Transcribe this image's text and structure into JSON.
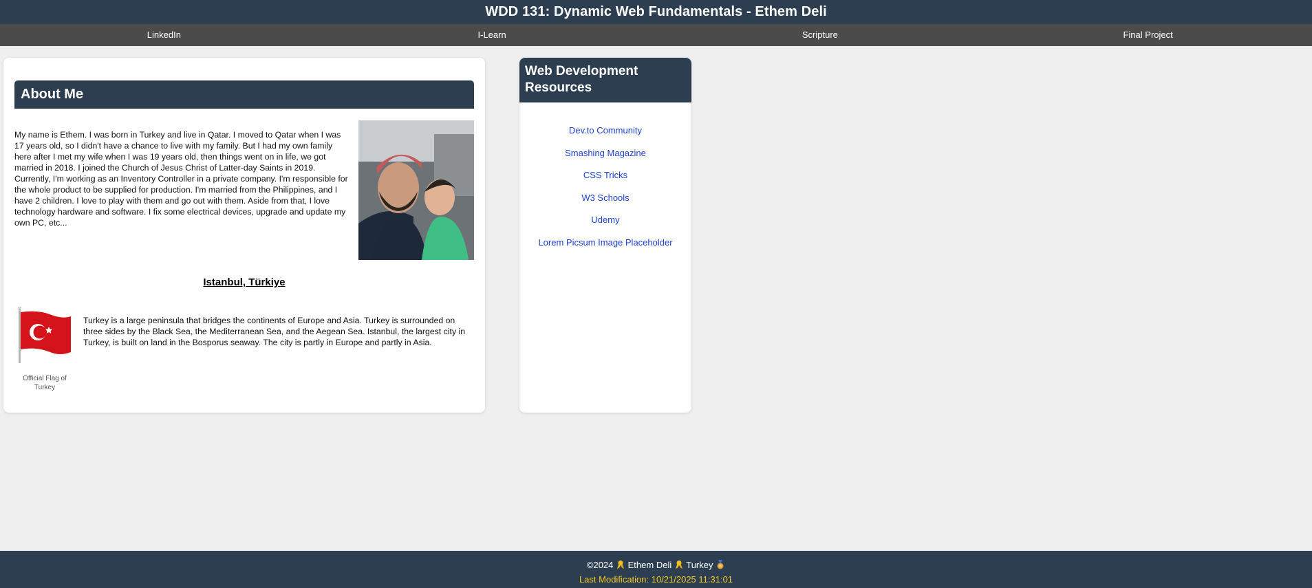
{
  "header": {
    "title": "WDD 131: Dynamic Web Fundamentals - Ethem Deli"
  },
  "nav": {
    "items": [
      {
        "label": "LinkedIn"
      },
      {
        "label": "I-Learn"
      },
      {
        "label": "Scripture"
      },
      {
        "label": "Final Project"
      }
    ]
  },
  "about": {
    "heading": "About Me",
    "bio": "My name is Ethem. I was born in Turkey and live in Qatar. I moved to Qatar when I was 17 years old, so I didn't have a chance to live with my family. But I had my own family here after I met my wife when I was 19 years old, then things went on in life, we got married in 2018. I joined the Church of Jesus Christ of Latter-day Saints in 2019. Currently, I'm working as an Inventory Controller in a private company. I'm responsible for the whole product to be supplied for production. I'm married from the Philippines, and I have 2 children. I love to play with them and go out with them. Aside from that, I love technology hardware and software. I fix some electrical devices, upgrade and update my own PC, etc...",
    "place_title": "Istanbul, Türkiye",
    "place_text": "Turkey is a large peninsula that bridges the continents of Europe and Asia. Turkey is surrounded on three sides by the Black Sea, the Mediterranean Sea, and the Aegean Sea. Istanbul, the largest city in Turkey, is built on land in the Bosporus seaway. The city is partly in Europe and partly in Asia.",
    "flag_caption": "Official Flag of Turkey"
  },
  "resources": {
    "heading": "Web Development Resources",
    "links": [
      {
        "label": "Dev.to Community"
      },
      {
        "label": "Smashing Magazine"
      },
      {
        "label": "CSS Tricks"
      },
      {
        "label": "W3 Schools"
      },
      {
        "label": "Udemy"
      },
      {
        "label": "Lorem Picsum Image Placeholder"
      }
    ]
  },
  "footer": {
    "copyright": "©2024",
    "name": "Ethem Deli",
    "country": "Turkey",
    "last_modified": "Last Modification: 10/21/2025 11:31:01"
  },
  "colors": {
    "header_bg": "#2c3e50",
    "nav_bg": "#4b4b4b",
    "link": "#1a3fd6",
    "footer_accent": "#f0c929"
  }
}
